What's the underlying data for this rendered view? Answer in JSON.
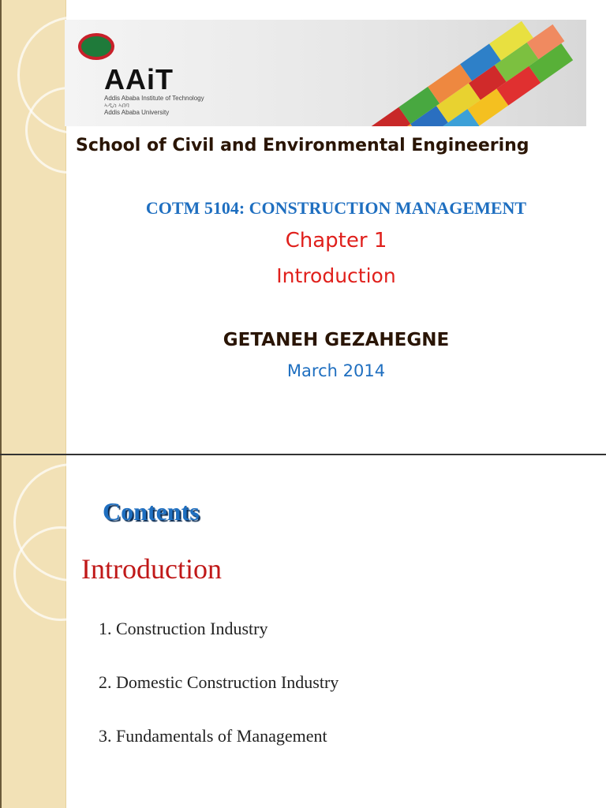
{
  "slide1": {
    "banner": {
      "logo": "AAiT",
      "sub1": "Addis Ababa Institute of Technology",
      "sub2": "Addis Ababa University"
    },
    "school": "School of Civil and Environmental Engineering",
    "course": "COTM 5104: CONSTRUCTION MANAGEMENT",
    "chapter": "Chapter 1",
    "chapter_title": "Introduction",
    "author": "GETANEH GEZAHEGNE",
    "date": "March 2014"
  },
  "slide2": {
    "heading": "Contents",
    "subheading": "Introduction",
    "items": [
      "1. Construction Industry",
      "2. Domestic Construction Industry",
      "3. Fundamentals of Management"
    ]
  },
  "colors": {
    "blue": "#1f6fc0",
    "red": "#e0201c",
    "dark": "#3a1a0a"
  }
}
